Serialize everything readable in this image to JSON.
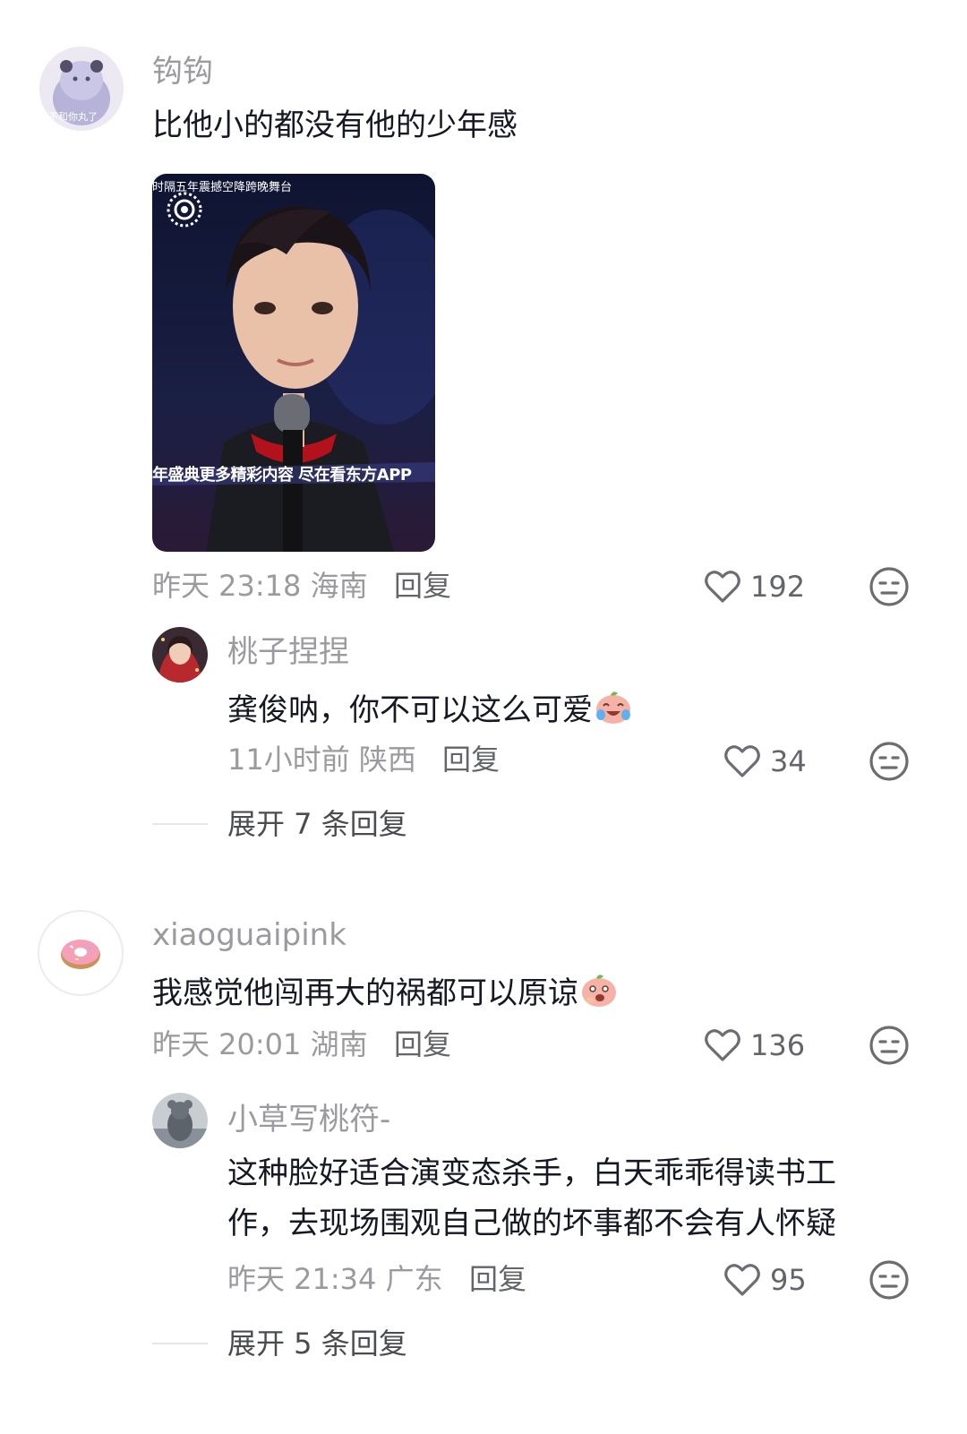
{
  "comments": [
    {
      "username": "钩钩",
      "avatar_text": "不和你丸了",
      "text": "比他小的都没有他的少年感",
      "image": {
        "caption_top": "时隔五年震撼空降跨晚舞台",
        "caption_bottom": "年盛典更多精彩内容  尽在看东方APP"
      },
      "time": "昨天 23:18 海南",
      "reply_label": "回复",
      "likes": "192",
      "replies": [
        {
          "username": "桃子捏捏",
          "text": "龚俊呐，你不可以这么可爱",
          "emoji": "crying-laughing-peach-emoji",
          "time": "11小时前 陕西",
          "reply_label": "回复",
          "likes": "34"
        }
      ],
      "expand_label": "展开 7 条回复"
    },
    {
      "username": "xiaoguaipink",
      "text": "我感觉他闯再大的祸都可以原谅",
      "emoji": "shy-peach-emoji",
      "time": "昨天 20:01 湖南",
      "reply_label": "回复",
      "likes": "136",
      "replies": [
        {
          "username": "小草写桃符-",
          "text_line1": "这种脸好适合演变态杀手，白天乖乖得读书工",
          "text_line2": "作，去现场围观自己做的坏事都不会有人怀疑",
          "time": "昨天 21:34 广东",
          "reply_label": "回复",
          "likes": "95"
        }
      ],
      "expand_label": "展开 5 条回复"
    }
  ],
  "icons": {
    "like": "heart-outline-icon",
    "dislike": "meh-face-icon"
  },
  "colors": {
    "username": "#9a9aa0",
    "text": "#161823",
    "meta": "#9a9aa0",
    "reply": "#63656b",
    "icon": "#6b6d72"
  }
}
